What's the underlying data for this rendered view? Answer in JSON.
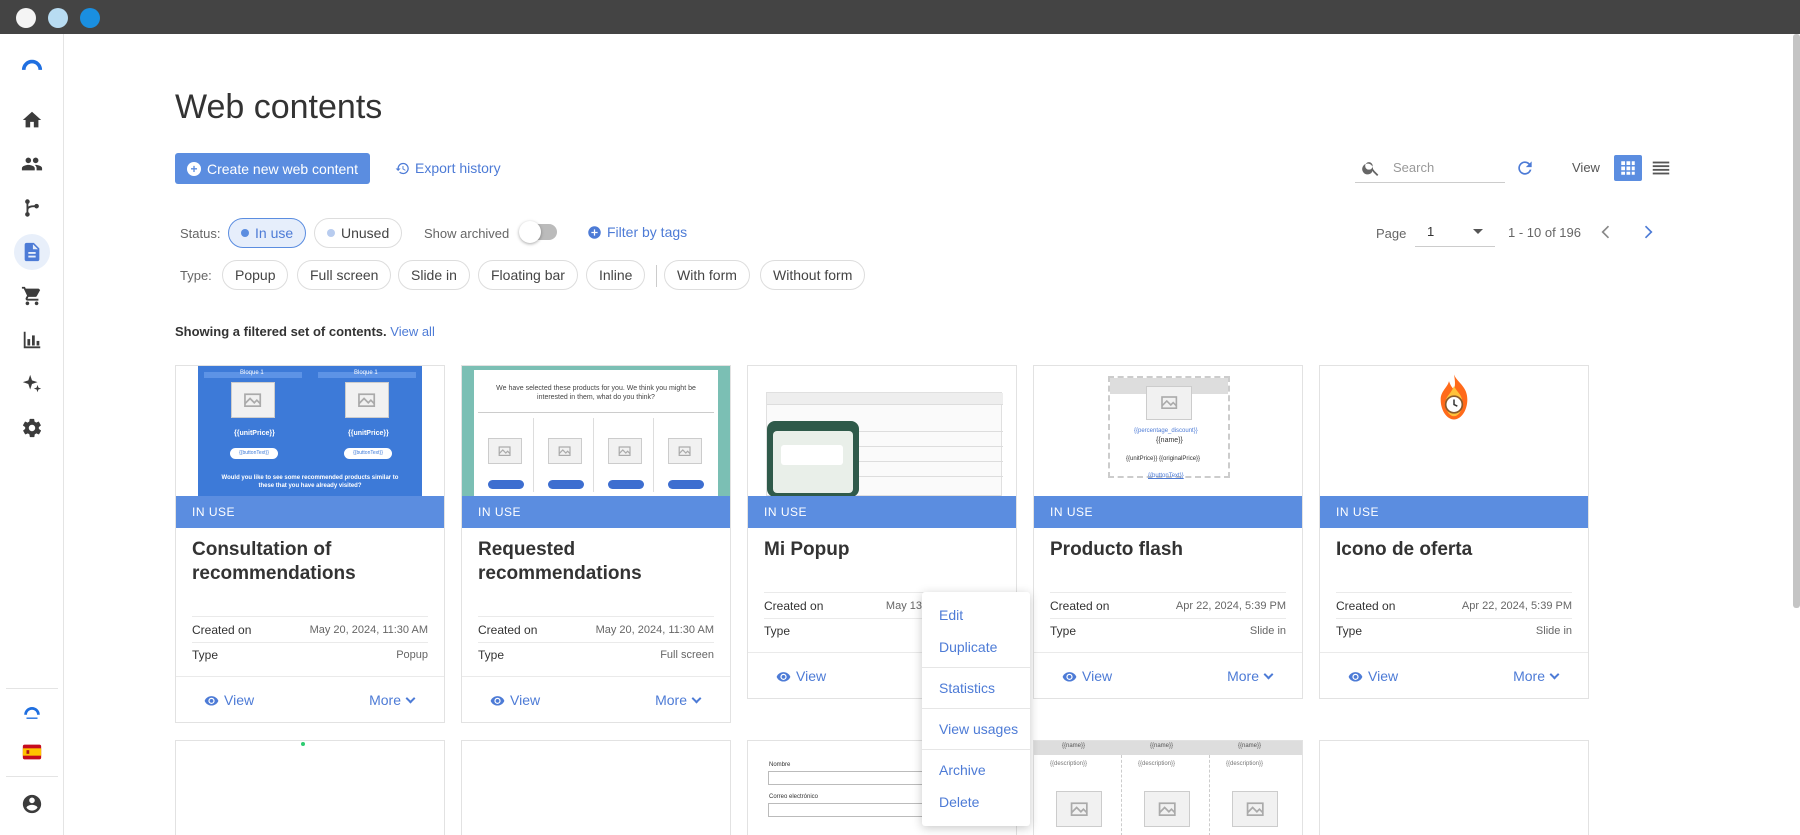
{
  "page": {
    "title": "Web contents",
    "create_button": "Create new web content",
    "export_history": "Export history",
    "search_placeholder": "Search",
    "view_label": "View"
  },
  "filters": {
    "status_label": "Status:",
    "status_in_use": "In use",
    "status_unused": "Unused",
    "show_archived": "Show archived",
    "show_archived_on": false,
    "filter_by_tags": "Filter by tags",
    "type_label": "Type:",
    "types": [
      "Popup",
      "Full screen",
      "Slide in",
      "Floating bar",
      "Inline",
      "With form",
      "Without form"
    ]
  },
  "pagination": {
    "page_label": "Page",
    "page_value": "1",
    "range": "1 - 10 of 196"
  },
  "filter_note": {
    "text": "Showing a filtered set of contents.",
    "link": "View all"
  },
  "card_labels": {
    "status": "IN USE",
    "created_on": "Created on",
    "type": "Type",
    "view": "View",
    "more": "More"
  },
  "cards": [
    {
      "title": "Consultation of recommendations",
      "created": "May 20, 2024, 11:30 AM",
      "type": "Popup"
    },
    {
      "title": "Requested recommendations",
      "created": "May 20, 2024, 11:30 AM",
      "type": "Full screen"
    },
    {
      "title": "Mi Popup",
      "created": "May 13",
      "type": ""
    },
    {
      "title": "Producto flash",
      "created": "Apr 22, 2024, 5:39 PM",
      "type": "Slide in"
    },
    {
      "title": "Icono de oferta",
      "created": "Apr 22, 2024, 5:39 PM",
      "type": "Slide in"
    }
  ],
  "thumb_text": {
    "block1": "Bloque 1",
    "unit_price": "{{unitPrice}}",
    "button_text": "{{buttonText}}",
    "consult_question": "Would you like to see some recommended products similar to these that you have already visited?",
    "requested_heading": "We have selected these products for you. We think you might be interested in them, what do you think?",
    "percentage": "{{percentage_discount}}",
    "name": "{{name}}",
    "prices": "{{unitPrice}} {{originalPrice}}",
    "button": "{{buttonText}}",
    "name_token": "{{name}}",
    "description": "{{description}}",
    "form_name": "Nombre",
    "form_email": "Correo electrónico"
  },
  "context_menu": {
    "items": [
      "Edit",
      "Duplicate",
      "Statistics",
      "View usages",
      "Archive",
      "Delete"
    ]
  },
  "sidebar": {
    "items": [
      "home-icon",
      "people-icon",
      "flow-icon",
      "document-icon",
      "cart-icon",
      "chart-icon",
      "sparkle-icon",
      "gear-icon"
    ],
    "bottom": [
      "brand-logo-icon",
      "spain-flag-icon",
      "account-icon"
    ]
  },
  "colors": {
    "accent": "#5b8de0",
    "link": "#4d7bd6",
    "titlebar": "#444444"
  }
}
